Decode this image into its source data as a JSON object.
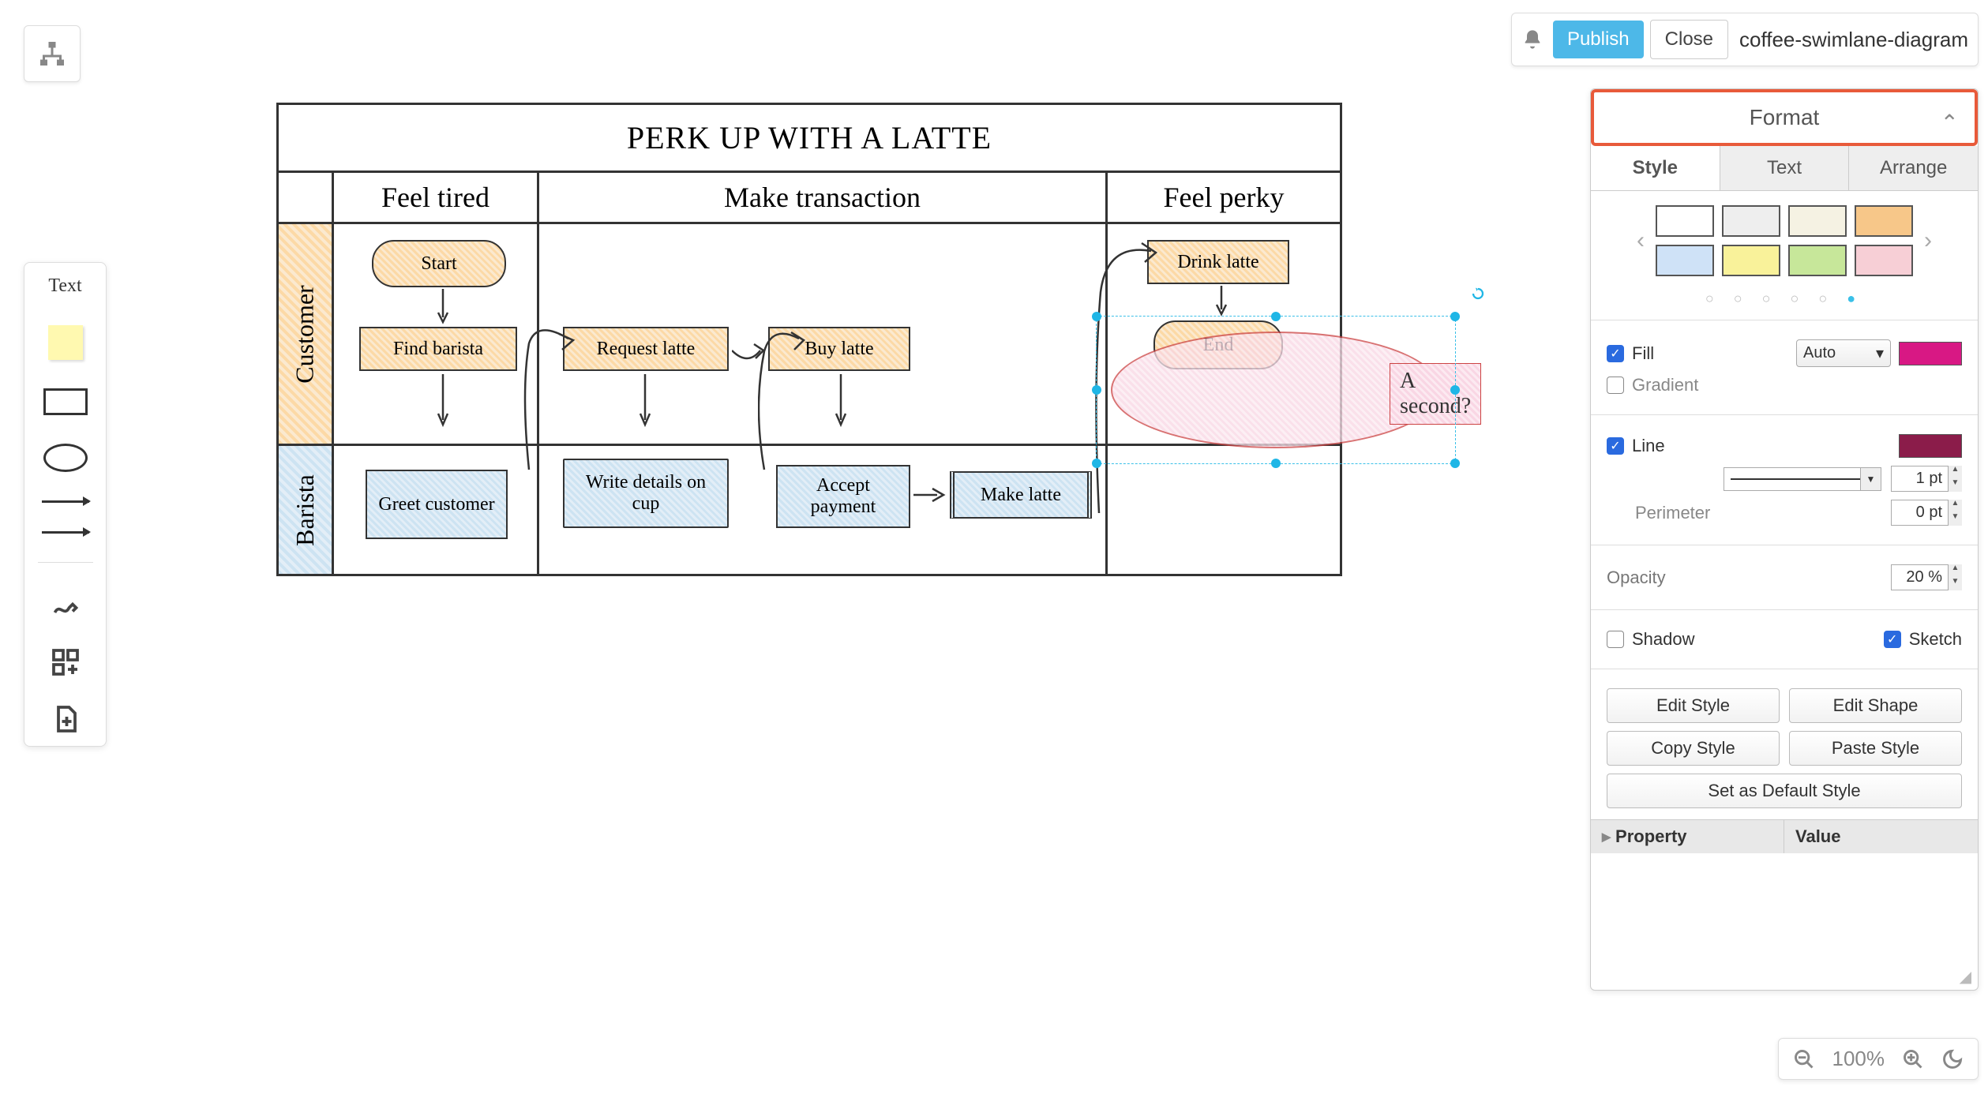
{
  "app": {
    "filename": "coffee-swimlane-diagram"
  },
  "topbar": {
    "publish": "Publish",
    "close": "Close"
  },
  "left_toolbar": {
    "text_label": "Text"
  },
  "diagram": {
    "title": "PERK UP WITH A LATTE",
    "phases": [
      "Feel tired",
      "Make transaction",
      "Feel perky"
    ],
    "lanes": {
      "customer": "Customer",
      "barista": "Barista"
    },
    "nodes": {
      "start": "Start",
      "find_barista": "Find barista",
      "request_latte": "Request latte",
      "buy_latte": "Buy latte",
      "drink_latte": "Drink latte",
      "end": "End",
      "greet_customer": "Greet customer",
      "write_details": "Write details on cup",
      "accept_payment": "Accept payment",
      "make_latte": "Make latte"
    },
    "callout": "A second?"
  },
  "format_panel": {
    "header": "Format",
    "tabs": {
      "style": "Style",
      "text": "Text",
      "arrange": "Arrange"
    },
    "swatches": [
      [
        "#ffffff",
        "#eeeeee",
        "#f5f2e3",
        "#f7c789"
      ],
      [
        "#cfe2f7",
        "#f9f29a",
        "#c7e79a",
        "#f7cfd6"
      ]
    ],
    "fill": {
      "label": "Fill",
      "mode": "Auto",
      "color": "#d81884"
    },
    "gradient": {
      "label": "Gradient"
    },
    "line": {
      "label": "Line",
      "color": "#8b1c4a",
      "width": "1 pt"
    },
    "perimeter": {
      "label": "Perimeter",
      "value": "0 pt"
    },
    "opacity": {
      "label": "Opacity",
      "value": "20 %"
    },
    "shadow": {
      "label": "Shadow"
    },
    "sketch": {
      "label": "Sketch"
    },
    "buttons": {
      "edit_style": "Edit Style",
      "edit_shape": "Edit Shape",
      "copy_style": "Copy Style",
      "paste_style": "Paste Style",
      "set_default": "Set as Default Style"
    },
    "property_table": {
      "property": "Property",
      "value": "Value"
    }
  },
  "zoom": {
    "level": "100%"
  }
}
